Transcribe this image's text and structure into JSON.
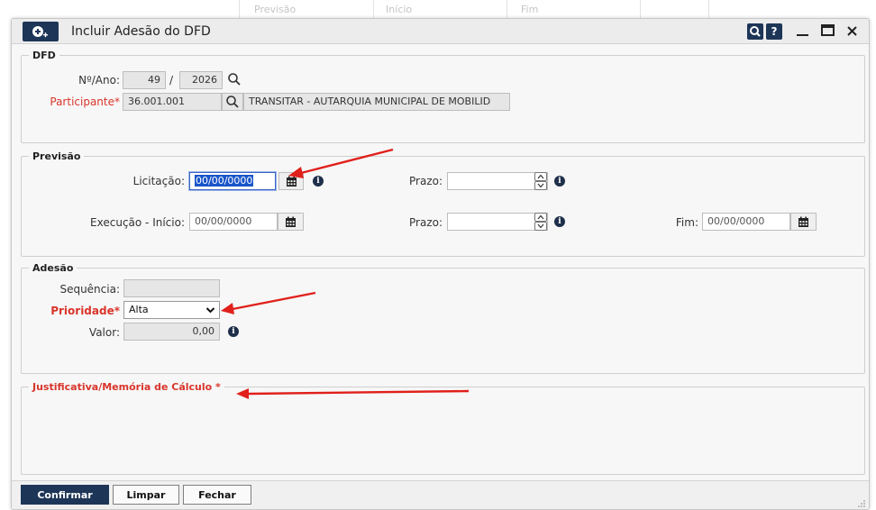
{
  "background_table": {
    "columns": [
      "Previsão",
      "Início",
      "Fim"
    ]
  },
  "dialog": {
    "title": "Incluir Adesão do DFD",
    "title_buttons": {
      "search": "Q",
      "help": "?"
    }
  },
  "dfd": {
    "legend": "DFD",
    "numero_ano_label": "Nº/Ano:",
    "numero": "49",
    "separator": "/",
    "ano": "2026",
    "participante_label": "Participante*",
    "participante_code": "36.001.001",
    "participante_name": "TRANSITAR - AUTARQUIA MUNICIPAL DE MOBILID"
  },
  "previsao": {
    "legend": "Previsão",
    "licitacao_label": "Licitação:",
    "licitacao_value": "00/00/0000",
    "prazo_label_1": "Prazo:",
    "prazo_value_1": "",
    "execucao_label": "Execução - Início:",
    "execucao_value": "00/00/0000",
    "prazo_label_2": "Prazo:",
    "prazo_value_2": "",
    "fim_label": "Fim:",
    "fim_value": "00/00/0000"
  },
  "adesao": {
    "legend": "Adesão",
    "sequencia_label": "Sequência:",
    "sequencia_value": "",
    "prioridade_label": "Prioridade*",
    "prioridade_value": "Alta",
    "valor_label": "Valor:",
    "valor_value": "0,00"
  },
  "justificativa": {
    "legend": "Justificativa/Memória de Cálculo *"
  },
  "footer": {
    "confirmar": "Confirmar",
    "limpar": "Limpar",
    "fechar": "Fechar"
  },
  "colors": {
    "brand": "#1d3557",
    "required": "#d9352b",
    "annotation": "#e0201b",
    "selection": "#1a55c9"
  }
}
